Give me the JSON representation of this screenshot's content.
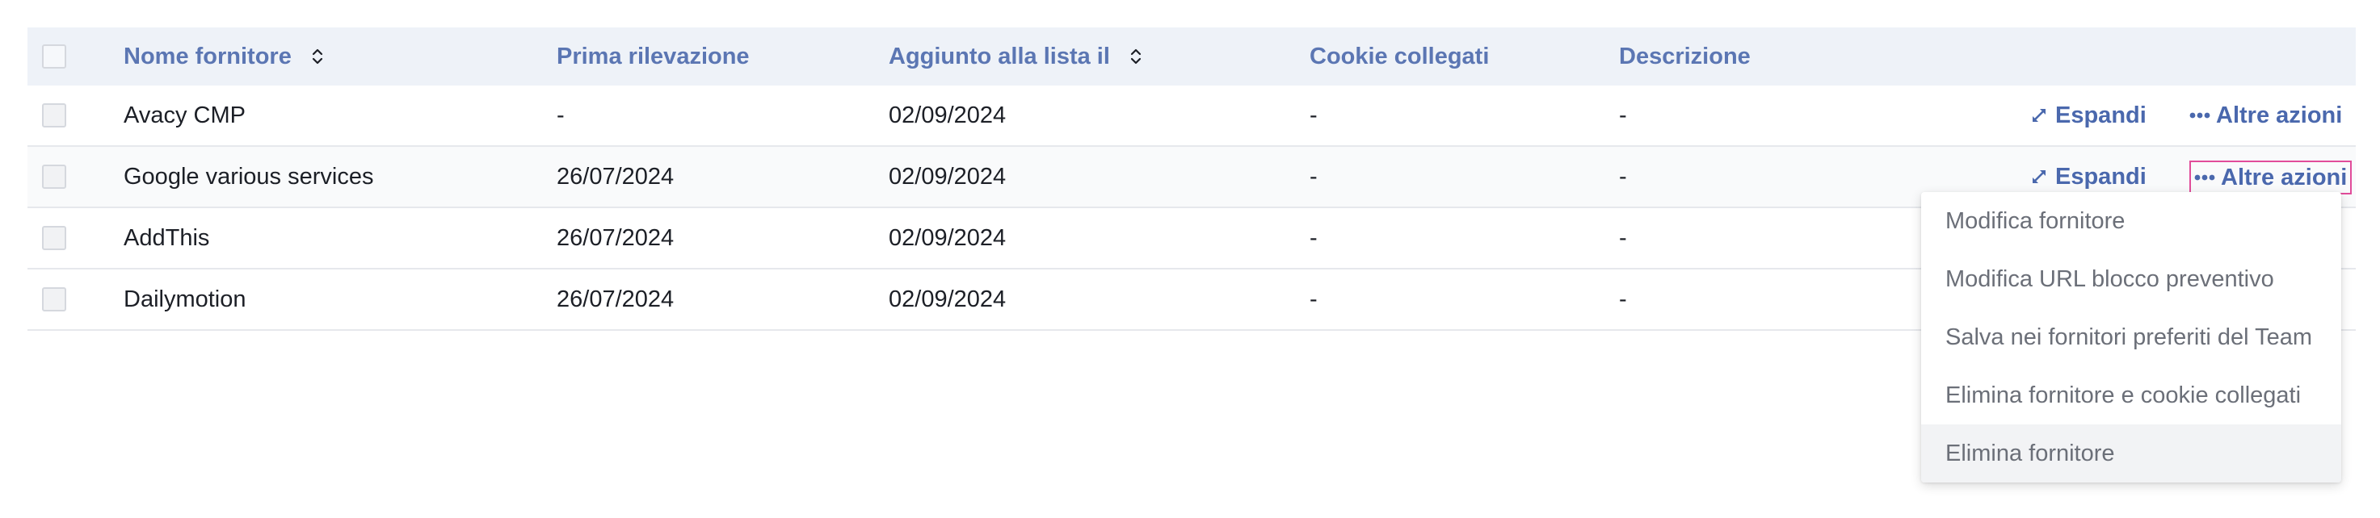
{
  "table": {
    "columns": {
      "name": "Nome fornitore",
      "first_detected": "Prima rilevazione",
      "added_on": "Aggiunto alla lista il",
      "linked_cookies": "Cookie collegati",
      "description": "Descrizione"
    },
    "rows": [
      {
        "name": "Avacy CMP",
        "first_detected": "-",
        "added_on": "02/09/2024",
        "linked_cookies": "-",
        "description": "-"
      },
      {
        "name": "Google various services",
        "first_detected": "26/07/2024",
        "added_on": "02/09/2024",
        "linked_cookies": "-",
        "description": "-"
      },
      {
        "name": "AddThis",
        "first_detected": "26/07/2024",
        "added_on": "02/09/2024",
        "linked_cookies": "-",
        "description": "-"
      },
      {
        "name": "Dailymotion",
        "first_detected": "26/07/2024",
        "added_on": "02/09/2024",
        "linked_cookies": "-",
        "description": "-"
      }
    ],
    "actions": {
      "expand": "Espandi",
      "more": "Altre azioni"
    }
  },
  "menu": {
    "items": [
      "Modifica fornitore",
      "Modifica URL blocco preventivo",
      "Salva nei fornitori preferiti del Team",
      "Elimina fornitore e cookie collegati",
      "Elimina fornitore"
    ]
  },
  "colors": {
    "header_text": "#5b76b3",
    "action_text": "#4a68ad",
    "focus_outline": "#e14c9a",
    "header_background": "#eef2f8"
  }
}
